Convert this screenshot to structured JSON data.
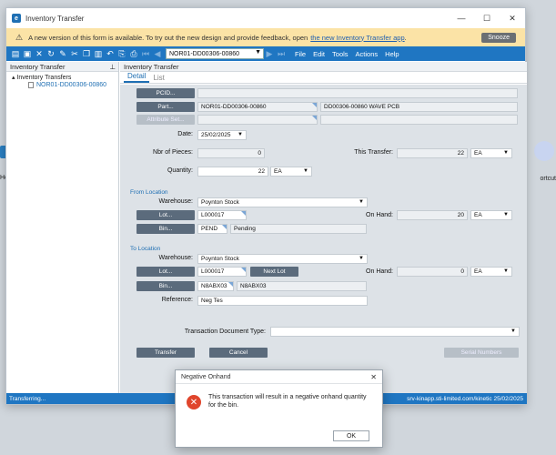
{
  "background": {
    "left_text": "Ho",
    "right_text": "ortcut"
  },
  "window": {
    "title": "Inventory Transfer",
    "controls": [
      "—",
      "☐",
      "✕"
    ]
  },
  "banner": {
    "message": "A new version of this form is available. To try out the new design and provide feedback, open",
    "link": "the new Inventory Transfer app",
    "link_suffix": ".",
    "snooze": "Snooze"
  },
  "toolbar": {
    "record": "NOR01-DD00306-00860",
    "menus": [
      "File",
      "Edit",
      "Tools",
      "Actions",
      "Help"
    ]
  },
  "leftpane": {
    "header": "Inventory Transfer",
    "tree_root": "Inventory Transfers",
    "tree_child": "NOR01-DD00306-00860"
  },
  "main": {
    "header": "Inventory Transfer",
    "tabs": [
      "Detail",
      "List"
    ]
  },
  "form": {
    "pcid_btn": "PCID...",
    "part_btn": "Part...",
    "part_value": "NOR01-DD00306-00860",
    "part_desc": "DD00306-00860 WAVE PCB",
    "attribute_btn": "Attribute Set...",
    "date_label": "Date:",
    "date_value": "25/02/2025",
    "nbr_pieces_label": "Nbr of Pieces:",
    "nbr_pieces_value": "0",
    "this_transfer_label": "This Transfer:",
    "this_transfer_value": "22",
    "this_transfer_uom": "EA",
    "quantity_label": "Quantity:",
    "quantity_value": "22",
    "quantity_uom": "EA",
    "from_section": "From Location",
    "from_wh_label": "Warehouse:",
    "from_wh_value": "Poynton Stock",
    "from_lot_btn": "Lot...",
    "from_lot_value": "L000017",
    "on_hand_label": "On Hand:",
    "from_on_hand_value": "20",
    "from_on_hand_uom": "EA",
    "from_bin_btn": "Bin...",
    "from_bin_value": "PEND",
    "from_bin_desc": "Pending",
    "to_section": "To Location",
    "to_wh_label": "Warehouse:",
    "to_wh_value": "Poynton Stock",
    "to_lot_btn": "Lot...",
    "to_lot_value": "L000017",
    "next_lot_btn": "Next Lot",
    "to_on_hand_label": "On Hand:",
    "to_on_hand_value": "0",
    "to_on_hand_uom": "EA",
    "to_bin_btn": "Bin...",
    "to_bin_value": "N8ABX03",
    "to_bin_desc": "N8ABX03",
    "reference_label": "Reference:",
    "reference_value": "Neg Tes",
    "trans_doc_label": "Transaction Document Type:",
    "trans_doc_value": "",
    "transfer_btn": "Transfer",
    "cancel_btn": "Cancel",
    "serial_btn": "Serial Numbers"
  },
  "statusbar": {
    "left": "Transferring...",
    "right": "srv-kinapp.sti-limited.com/kinetic   25/02/2025"
  },
  "dialog": {
    "title": "Negative Onhand",
    "message": "This transaction will result in a negative onhand quantity for the bin.",
    "ok": "OK"
  },
  "colors": {
    "accent": "#1f76c2",
    "banner": "#fbe3a6",
    "error": "#e0452c"
  }
}
